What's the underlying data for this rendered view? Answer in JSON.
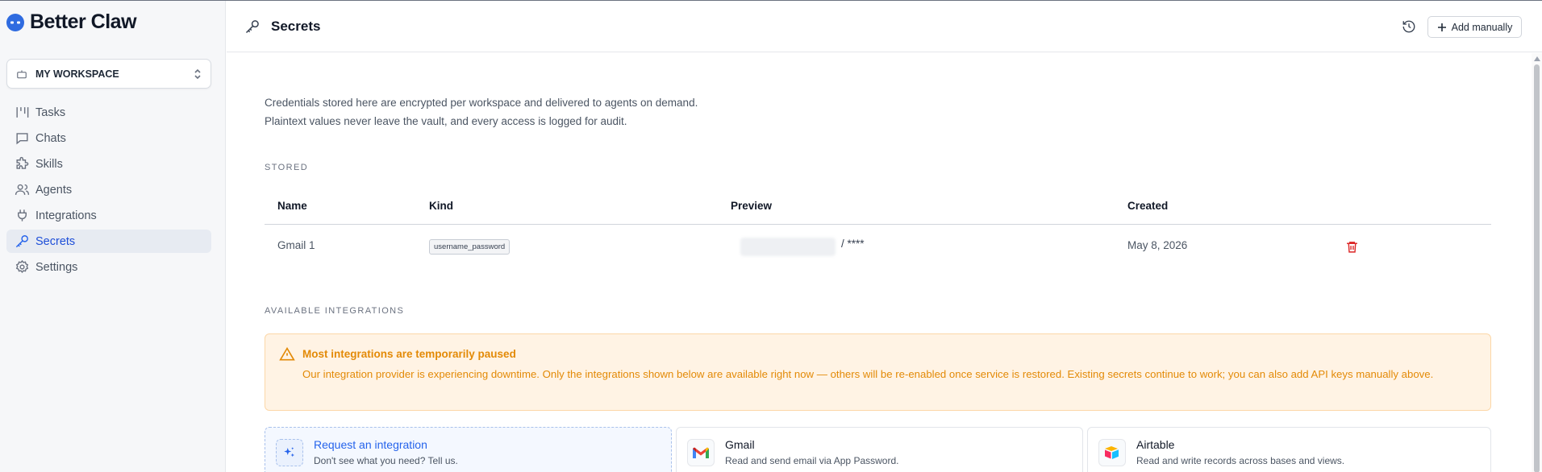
{
  "app": {
    "brand": "Better Claw"
  },
  "workspace": {
    "label": "MY WORKSPACE"
  },
  "nav": [
    {
      "label": "Tasks",
      "icon": "tasks-icon",
      "active": false
    },
    {
      "label": "Chats",
      "icon": "chat-icon",
      "active": false
    },
    {
      "label": "Skills",
      "icon": "puzzle-icon",
      "active": false
    },
    {
      "label": "Agents",
      "icon": "users-icon",
      "active": false
    },
    {
      "label": "Integrations",
      "icon": "plug-icon",
      "active": false
    },
    {
      "label": "Secrets",
      "icon": "key-icon",
      "active": true
    },
    {
      "label": "Settings",
      "icon": "gear-icon",
      "active": false
    }
  ],
  "header": {
    "title": "Secrets",
    "add_label": "Add manually"
  },
  "intro": {
    "line1": "Credentials stored here are encrypted per workspace and delivered to agents on demand.",
    "line2": "Plaintext values never leave the vault, and every access is logged for audit."
  },
  "stored": {
    "label": "STORED",
    "columns": [
      "Name",
      "Kind",
      "Preview",
      "Created"
    ],
    "rows": [
      {
        "name": "Gmail 1",
        "kind": "username_password",
        "preview_suffix": "/ ****",
        "created": "May 8, 2026"
      }
    ]
  },
  "integrations": {
    "label": "AVAILABLE INTEGRATIONS",
    "alert": {
      "title": "Most integrations are temporarily paused",
      "body": "Our integration provider is experiencing downtime. Only the integrations shown below are available right now — others will be re-enabled once service is restored. Existing secrets continue to work; you can also add API keys manually above."
    },
    "cards": [
      {
        "title": "Request an integration",
        "desc": "Don't see what you need? Tell us.",
        "icon": "sparkle-icon"
      },
      {
        "title": "Gmail",
        "desc": "Read and send email via App Password.",
        "icon": "gmail-icon"
      },
      {
        "title": "Airtable",
        "desc": "Read and write records across bases and views.",
        "icon": "airtable-icon"
      }
    ]
  },
  "colors": {
    "accent": "#2563eb",
    "warning_text": "#e38a07",
    "warning_bg": "#fff3e4",
    "danger": "#dc2626"
  }
}
